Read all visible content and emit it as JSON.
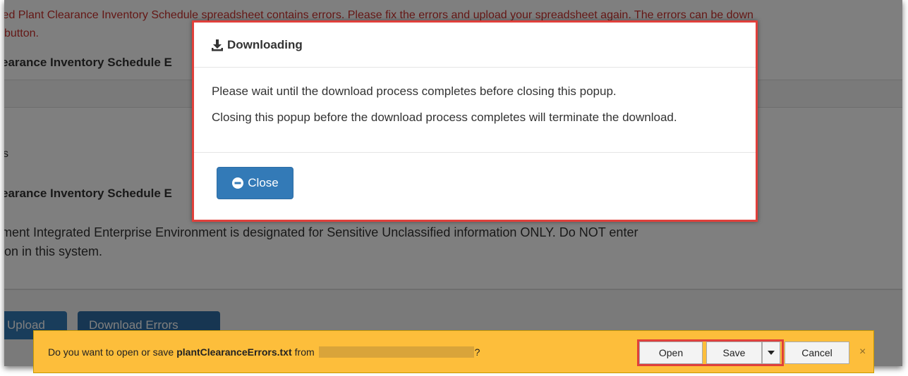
{
  "background": {
    "error_line1": "led Plant Clearance Inventory Schedule spreadsheet contains errors. Please fix the errors and upload your spreadsheet again. The errors can be down",
    "error_line2": " button.",
    "heading1": "earance Inventory Schedule E",
    "fragment_s": "s",
    "heading2": "earance Inventory Schedule E",
    "notice_line1": "ment Integrated Enterprise Environment is designated for Sensitive Unclassified information ONLY. Do NOT enter",
    "notice_line2": "ion in this system.",
    "upload_label": "Upload",
    "download_errors_label": "Download Errors"
  },
  "modal": {
    "title": "Downloading",
    "line1": "Please wait until the download process completes before closing this popup.",
    "line2": "Closing this popup before the download process completes will terminate the download.",
    "close_label": "Close"
  },
  "download_bar": {
    "prefix": "Do you want to open or save",
    "filename": "plantClearanceErrors.txt",
    "from_label": "from",
    "suffix": "?",
    "open_label": "Open",
    "save_label": "Save",
    "cancel_label": "Cancel",
    "dismiss_glyph": "×"
  },
  "colors": {
    "error_red": "#c9302c",
    "primary_blue": "#337ab7",
    "highlight_red": "#e0403b",
    "notification_yellow": "#fdbe3b"
  }
}
